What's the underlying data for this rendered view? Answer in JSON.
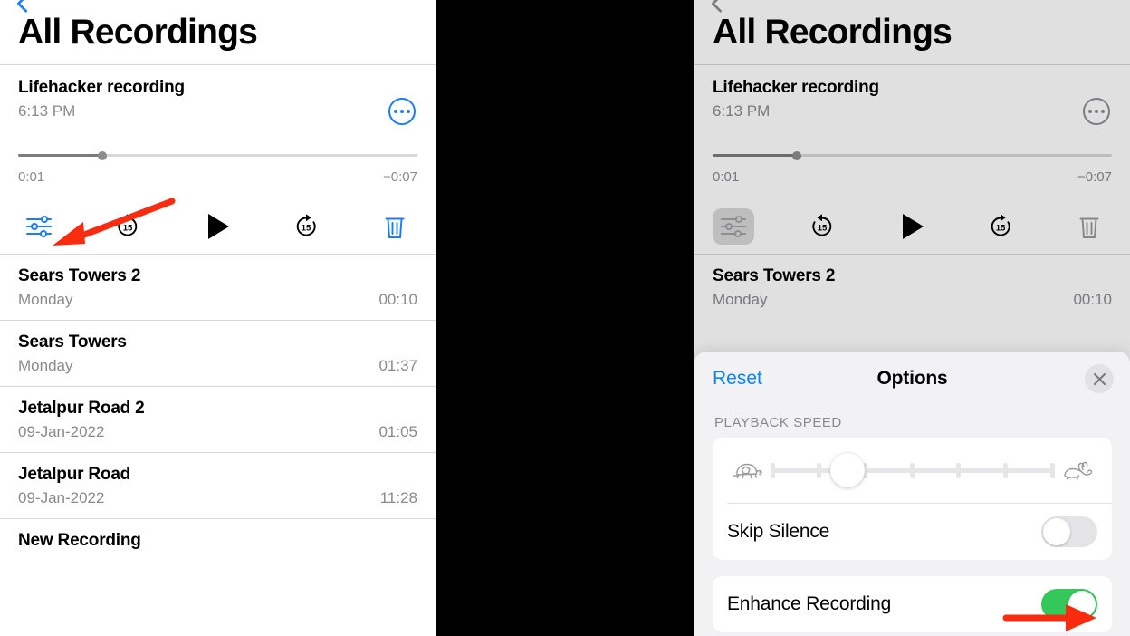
{
  "colors": {
    "accent_blue": "#1b7cff",
    "link_blue": "#0a84ff",
    "toggle_green": "#34c759",
    "annotation_red": "#fb2b10",
    "secondary_text": "#8a8a8e",
    "panel_gap_black": "#000000"
  },
  "left_panel": {
    "back_chevron_icon": "chevron-left-icon",
    "nav_title": "All Recordings",
    "player": {
      "title": "Lifehacker recording",
      "subtitle": "6:13 PM",
      "more_icon": "ellipsis-circle-icon",
      "elapsed_time": "0:01",
      "remaining_time": "−0:07",
      "progress_percent": 21,
      "controls": [
        {
          "name": "playback-options",
          "icon": "sliders-icon",
          "color": "#1b7cff"
        },
        {
          "name": "skip-back-15",
          "icon": "goback-15-icon",
          "label": "15",
          "color": "#000000"
        },
        {
          "name": "play",
          "icon": "play-icon",
          "color": "#000000"
        },
        {
          "name": "skip-forward-15",
          "icon": "goforward-15-icon",
          "label": "15",
          "color": "#000000"
        },
        {
          "name": "delete",
          "icon": "trash-icon",
          "color": "#1b7cff"
        }
      ]
    },
    "recordings": [
      {
        "title": "Sears Towers 2",
        "sub": "Monday",
        "duration": "00:10"
      },
      {
        "title": "Sears Towers",
        "sub": "Monday",
        "duration": "01:37"
      },
      {
        "title": "Jetalpur Road 2",
        "sub": "09-Jan-2022",
        "duration": "01:05"
      },
      {
        "title": "Jetalpur Road",
        "sub": "09-Jan-2022",
        "duration": "11:28"
      },
      {
        "title": "New Recording",
        "sub": "",
        "duration": ""
      }
    ]
  },
  "right_panel": {
    "back_chevron_icon": "chevron-left-icon",
    "nav_title": "All Recordings",
    "player": {
      "title": "Lifehacker recording",
      "subtitle": "6:13 PM",
      "more_icon": "ellipsis-circle-icon",
      "elapsed_time": "0:01",
      "remaining_time": "−0:07",
      "progress_percent": 21,
      "controls": [
        {
          "name": "playback-options",
          "icon": "sliders-icon",
          "color": "#9a9a9e"
        },
        {
          "name": "skip-back-15",
          "icon": "goback-15-icon",
          "label": "15",
          "color": "#000000"
        },
        {
          "name": "play",
          "icon": "play-icon",
          "color": "#000000"
        },
        {
          "name": "skip-forward-15",
          "icon": "goforward-15-icon",
          "label": "15",
          "color": "#000000"
        },
        {
          "name": "delete",
          "icon": "trash-icon",
          "color": "#9a9a9e"
        }
      ]
    },
    "recordings": [
      {
        "title": "Sears Towers 2",
        "sub": "Monday",
        "duration": "00:10"
      }
    ],
    "options_sheet": {
      "reset_label": "Reset",
      "title": "Options",
      "close_icon": "close-x-icon",
      "section_label": "PLAYBACK SPEED",
      "speed_slider": {
        "slow_icon": "tortoise-icon",
        "fast_icon": "hare-icon",
        "tick_count": 7,
        "selected_index": 2
      },
      "skip_silence": {
        "label": "Skip Silence",
        "enabled": false
      },
      "enhance_recording": {
        "label": "Enhance Recording",
        "enabled": true
      }
    }
  },
  "annotations": [
    {
      "name": "arrow-to-options-button-left",
      "target": "playback-options-button"
    },
    {
      "name": "arrow-to-enhance-toggle-right",
      "target": "enhance-recording-toggle"
    }
  ]
}
